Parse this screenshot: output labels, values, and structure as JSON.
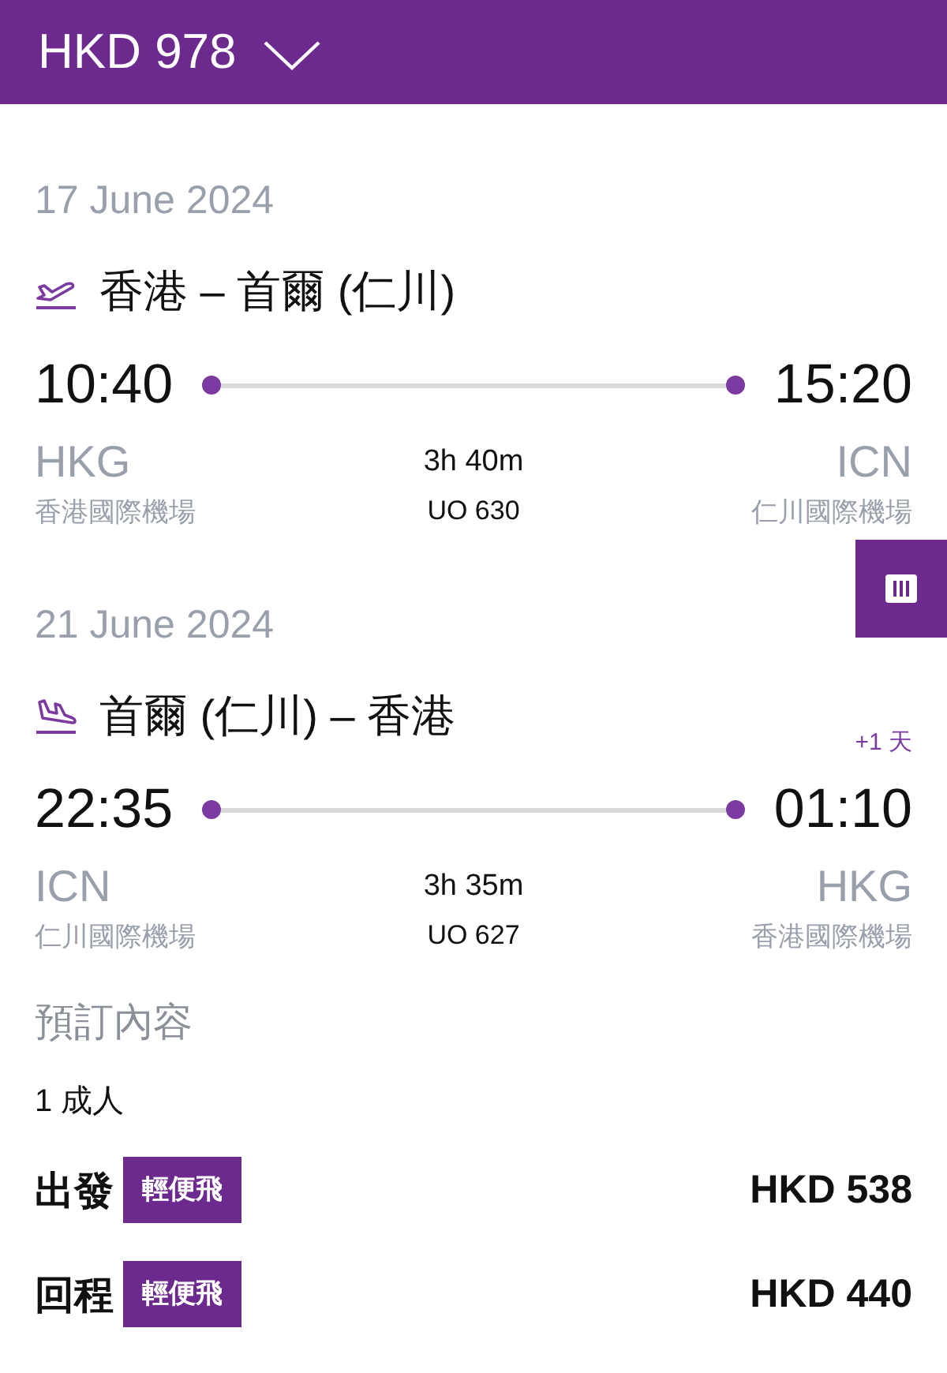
{
  "header": {
    "total": "HKD 978"
  },
  "legs": [
    {
      "kind": "departure",
      "date": "17 June 2024",
      "route": "香港 – 首爾 (仁川)",
      "depart_time": "10:40",
      "arrive_time": "15:20",
      "from_code": "HKG",
      "to_code": "ICN",
      "duration": "3h 40m",
      "from_airport": "香港國際機場",
      "flight": "UO 630",
      "to_airport": "仁川國際機場"
    },
    {
      "kind": "return",
      "date": "21 June 2024",
      "route": "首爾 (仁川) – 香港",
      "day_offset": "+1 天",
      "depart_time": "22:35",
      "arrive_time": "01:10",
      "from_code": "ICN",
      "to_code": "HKG",
      "duration": "3h 35m",
      "from_airport": "仁川國際機場",
      "flight": "UO 627",
      "to_airport": "香港國際機場"
    }
  ],
  "booking": {
    "title": "預訂內容",
    "passengers": "1 成人",
    "fares": [
      {
        "label": "出發",
        "fare_type": "輕便飛",
        "price": "HKD 538"
      },
      {
        "label": "回程",
        "fare_type": "輕便飛",
        "price": "HKD 440"
      }
    ]
  }
}
